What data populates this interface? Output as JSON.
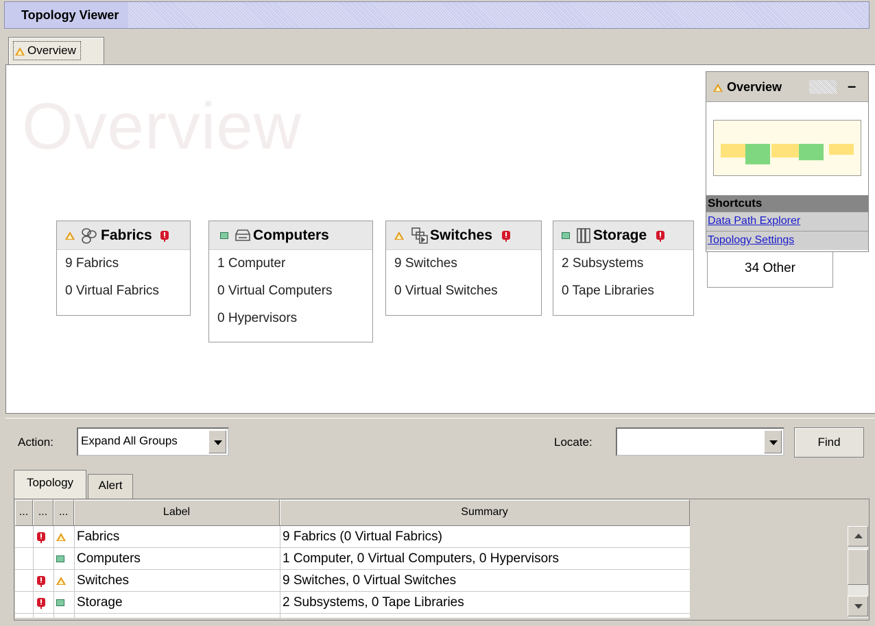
{
  "window": {
    "title": "Topology Viewer"
  },
  "top_tab": {
    "label": "Overview"
  },
  "canvas": {
    "watermark": "Overview",
    "groups": [
      {
        "name": "Fabrics",
        "status": "warning",
        "alert": true,
        "icon": "fabric-icon",
        "lines": [
          "9 Fabrics",
          "0 Virtual Fabrics"
        ]
      },
      {
        "name": "Computers",
        "status": "normal",
        "alert": false,
        "icon": "computer-icon",
        "lines": [
          "1 Computer",
          "0 Virtual Computers",
          "0 Hypervisors"
        ]
      },
      {
        "name": "Switches",
        "status": "warning",
        "alert": true,
        "icon": "switch-icon",
        "lines": [
          "9 Switches",
          "0 Virtual Switches"
        ]
      },
      {
        "name": "Storage",
        "status": "normal",
        "alert": true,
        "icon": "storage-icon",
        "lines": [
          "2 Subsystems",
          "0 Tape Libraries"
        ]
      }
    ],
    "other": "34 Other"
  },
  "overview_panel": {
    "title": "Overview",
    "minimize": "–",
    "shortcuts_header": "Shortcuts",
    "shortcuts": [
      "Data Path Explorer",
      "Topology Settings"
    ]
  },
  "action_bar": {
    "action_label": "Action:",
    "action_value": "Expand All Groups",
    "locate_label": "Locate:",
    "locate_value": "",
    "find_label": "Find"
  },
  "bottom_tabs": [
    "Topology",
    "Alert"
  ],
  "table": {
    "columns": [
      "...",
      "...",
      "...",
      "Label",
      "Summary"
    ],
    "rows": [
      {
        "alert": true,
        "status": "warning",
        "label": "Fabrics",
        "summary": "9 Fabrics (0 Virtual Fabrics)"
      },
      {
        "alert": false,
        "status": "normal",
        "label": "Computers",
        "summary": "1 Computer, 0 Virtual Computers, 0 Hypervisors"
      },
      {
        "alert": true,
        "status": "warning",
        "label": "Switches",
        "summary": "9 Switches, 0 Virtual Switches"
      },
      {
        "alert": true,
        "status": "normal",
        "label": "Storage",
        "summary": "2 Subsystems, 0 Tape Libraries"
      }
    ]
  },
  "colors": {
    "warning": "#e49a1c",
    "critical": "#d5172b",
    "normal": "#7fcaa0",
    "link": "#1a1acc"
  }
}
